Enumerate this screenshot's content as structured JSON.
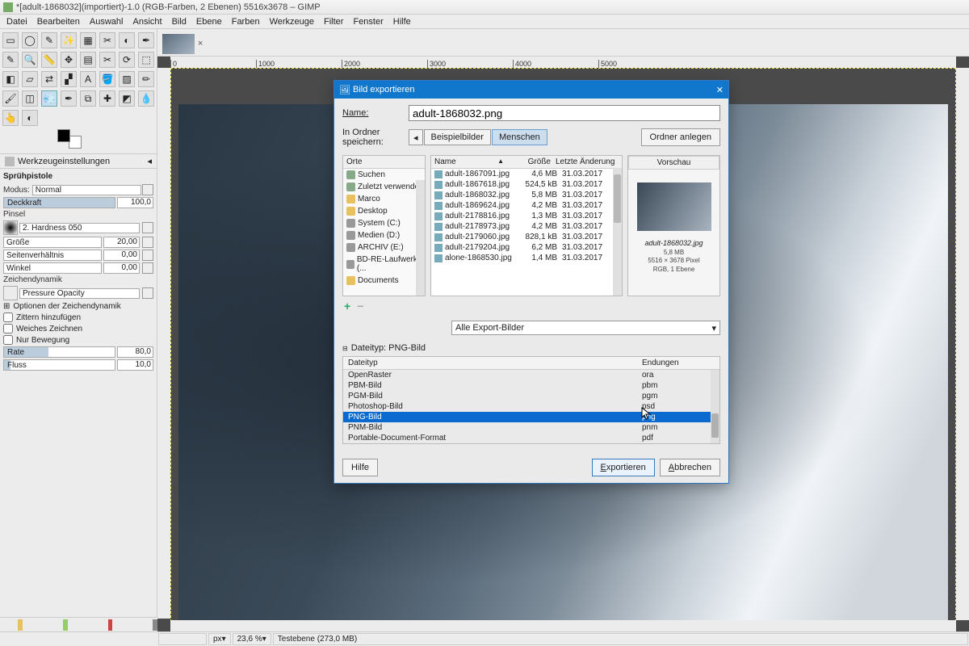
{
  "title": "*[adult-1868032](importiert)-1.0 (RGB-Farben, 2 Ebenen) 5516x3678 – GIMP",
  "menus": [
    "Datei",
    "Bearbeiten",
    "Auswahl",
    "Ansicht",
    "Bild",
    "Ebene",
    "Farben",
    "Werkzeuge",
    "Filter",
    "Fenster",
    "Hilfe"
  ],
  "ruler_marks": [
    "0",
    "1000",
    "2000",
    "3000",
    "4000",
    "5000"
  ],
  "tooloptions": {
    "tab": "Werkzeugeinstellungen",
    "tool_name": "Sprühpistole",
    "mode_label": "Modus:",
    "mode": "Normal",
    "opacity_label": "Deckkraft",
    "opacity": "100,0",
    "brush_label": "Pinsel",
    "brush": "2. Hardness 050",
    "size_label": "Größe",
    "size": "20,00",
    "aspect_label": "Seitenverhältnis",
    "aspect": "0,00",
    "angle_label": "Winkel",
    "angle": "0,00",
    "dyn_label": "Zeichendynamik",
    "dyn": "Pressure Opacity",
    "opt_dyn": "Optionen der Zeichendynamik",
    "jitter": "Zittern hinzufügen",
    "smooth": "Weiches Zeichnen",
    "motion": "Nur Bewegung",
    "rate_label": "Rate",
    "rate": "80,0",
    "flow_label": "Fluss",
    "flow": "10,0"
  },
  "dialog": {
    "title": "Bild exportieren",
    "name_label": "Name:",
    "name": "adult-1868032.png",
    "folder_label": "In Ordner speichern:",
    "crumb1": "Beispielbilder",
    "crumb2": "Menschen",
    "new_folder": "Ordner anlegen",
    "places_hd": "Orte",
    "places": [
      {
        "icon": "s",
        "label": "Suchen"
      },
      {
        "icon": "g",
        "label": "Zuletzt verwendet"
      },
      {
        "icon": "y",
        "label": "Marco"
      },
      {
        "icon": "y",
        "label": "Desktop"
      },
      {
        "icon": "d",
        "label": "System (C:)"
      },
      {
        "icon": "d",
        "label": "Medien (D:)"
      },
      {
        "icon": "d",
        "label": "ARCHIV (E:)"
      },
      {
        "icon": "d",
        "label": "BD-RE-Laufwerk (..."
      },
      {
        "icon": "y",
        "label": "Documents"
      }
    ],
    "files_hd": {
      "name": "Name",
      "size": "Größe",
      "date": "Letzte Änderung"
    },
    "files": [
      {
        "n": "adult-1867091.jpg",
        "s": "4,6 MB",
        "d": "31.03.2017"
      },
      {
        "n": "adult-1867618.jpg",
        "s": "524,5 kB",
        "d": "31.03.2017"
      },
      {
        "n": "adult-1868032.jpg",
        "s": "5,8 MB",
        "d": "31.03.2017"
      },
      {
        "n": "adult-1869624.jpg",
        "s": "4,2 MB",
        "d": "31.03.2017"
      },
      {
        "n": "adult-2178816.jpg",
        "s": "1,3 MB",
        "d": "31.03.2017"
      },
      {
        "n": "adult-2178973.jpg",
        "s": "4,2 MB",
        "d": "31.03.2017"
      },
      {
        "n": "adult-2179060.jpg",
        "s": "828,1 kB",
        "d": "31.03.2017"
      },
      {
        "n": "adult-2179204.jpg",
        "s": "6,2 MB",
        "d": "31.03.2017"
      },
      {
        "n": "alone-1868530.jpg",
        "s": "1,4 MB",
        "d": "31.03.2017"
      }
    ],
    "preview_hd": "Vorschau",
    "preview_name": "adult-1868032.jpg",
    "preview_size": "5,8 MB",
    "preview_dim": "5516 × 3678 Pixel",
    "preview_mode": "RGB, 1 Ebene",
    "filter": "Alle Export-Bilder",
    "filetype_label": "Dateityp: PNG-Bild",
    "ft_hd1": "Dateityp",
    "ft_hd2": "Endungen",
    "filetypes": [
      {
        "t": "OpenRaster",
        "e": "ora"
      },
      {
        "t": "PBM-Bild",
        "e": "pbm"
      },
      {
        "t": "PGM-Bild",
        "e": "pgm"
      },
      {
        "t": "Photoshop-Bild",
        "e": "psd"
      },
      {
        "t": "PNG-Bild",
        "e": "png",
        "sel": true
      },
      {
        "t": "PNM-Bild",
        "e": "pnm"
      },
      {
        "t": "Portable-Document-Format",
        "e": "pdf"
      }
    ],
    "help": "Hilfe",
    "export": "Exportieren",
    "cancel": "Abbrechen"
  },
  "status": {
    "unit": "px",
    "zoom": "23,6 %",
    "layer": "Testebene (273,0 MB)"
  }
}
